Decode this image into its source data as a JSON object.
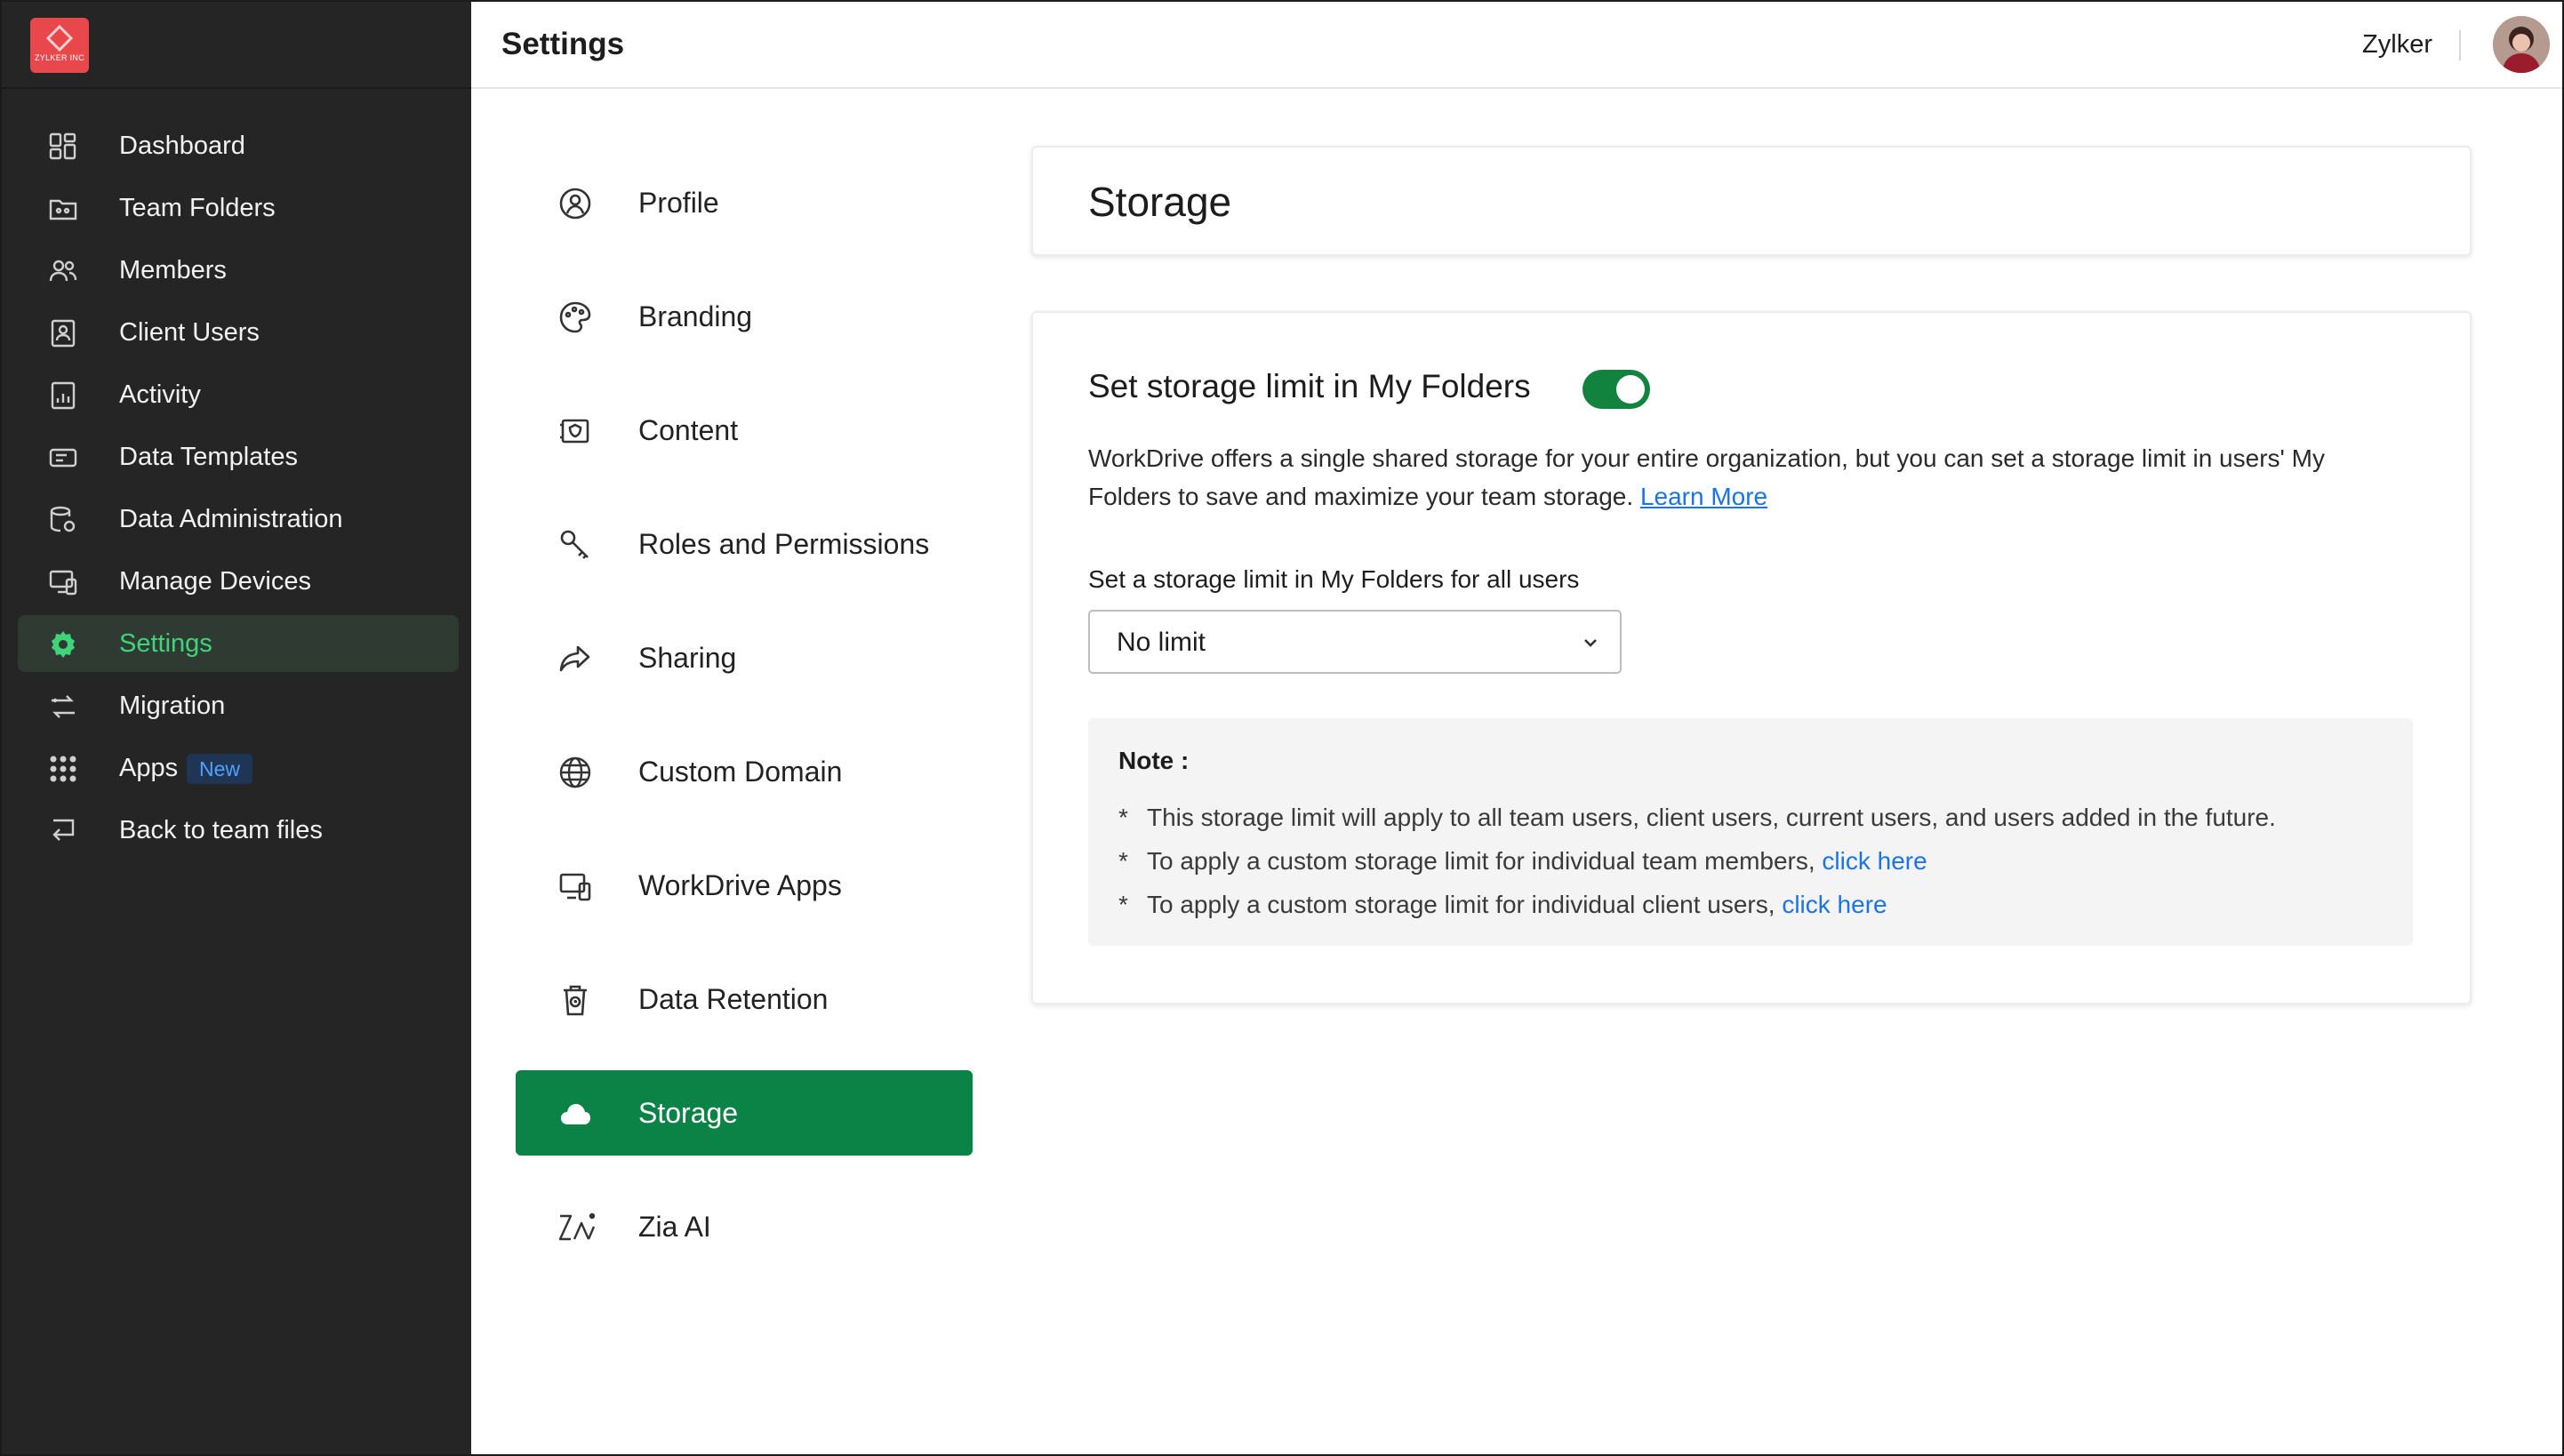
{
  "brand": {
    "logo_text": "ZYLKER INC",
    "accent": "#e8474c"
  },
  "header": {
    "title": "Settings",
    "org_name": "Zylker"
  },
  "sidebar": {
    "items": [
      {
        "label": "Dashboard",
        "icon": "dashboard-icon"
      },
      {
        "label": "Team Folders",
        "icon": "team-folder-icon"
      },
      {
        "label": "Members",
        "icon": "members-icon"
      },
      {
        "label": "Client Users",
        "icon": "client-users-icon"
      },
      {
        "label": "Activity",
        "icon": "activity-icon"
      },
      {
        "label": "Data Templates",
        "icon": "data-templates-icon"
      },
      {
        "label": "Data Administration",
        "icon": "data-administration-icon"
      },
      {
        "label": "Manage Devices",
        "icon": "manage-devices-icon"
      },
      {
        "label": "Settings",
        "icon": "settings-gear-icon",
        "active": true
      },
      {
        "label": "Migration",
        "icon": "migration-icon"
      },
      {
        "label": "Apps",
        "icon": "apps-grid-icon",
        "badge": "New"
      },
      {
        "label": "Back to team files",
        "icon": "back-arrow-icon"
      }
    ]
  },
  "settings_nav": {
    "items": [
      {
        "label": "Profile",
        "icon": "profile-icon"
      },
      {
        "label": "Branding",
        "icon": "palette-icon"
      },
      {
        "label": "Content",
        "icon": "content-shield-icon"
      },
      {
        "label": "Roles and Permissions",
        "icon": "key-icon"
      },
      {
        "label": "Sharing",
        "icon": "share-arrow-icon"
      },
      {
        "label": "Custom Domain",
        "icon": "globe-icon"
      },
      {
        "label": "WorkDrive Apps",
        "icon": "devices-icon"
      },
      {
        "label": "Data Retention",
        "icon": "trash-clock-icon"
      },
      {
        "label": "Storage",
        "icon": "cloud-icon",
        "active": true
      },
      {
        "label": "Zia AI",
        "icon": "zia-ai-icon"
      }
    ]
  },
  "storage": {
    "title": "Storage",
    "section_heading": "Set storage limit in My Folders",
    "toggle_on": true,
    "description": "WorkDrive offers a single shared storage for your entire organization, but you can set a storage limit in users' My Folders to save and maximize your team storage.",
    "learn_more": "Learn More",
    "limit_label": "Set a storage limit in My Folders for all users",
    "limit_value": "No limit",
    "note_title": "Note :",
    "notes": [
      {
        "text": "This storage limit will apply to all team users, client users, current users, and users added in the future.",
        "link": ""
      },
      {
        "text": "To apply a custom storage limit for individual team members,",
        "link": "click here"
      },
      {
        "text": "To apply a custom storage limit for individual client users,",
        "link": "click here"
      }
    ],
    "note_bullet": "*"
  },
  "colors": {
    "primary_green": "#0c8346",
    "sidebar_bg": "#252525",
    "link_blue": "#1a73e8"
  }
}
